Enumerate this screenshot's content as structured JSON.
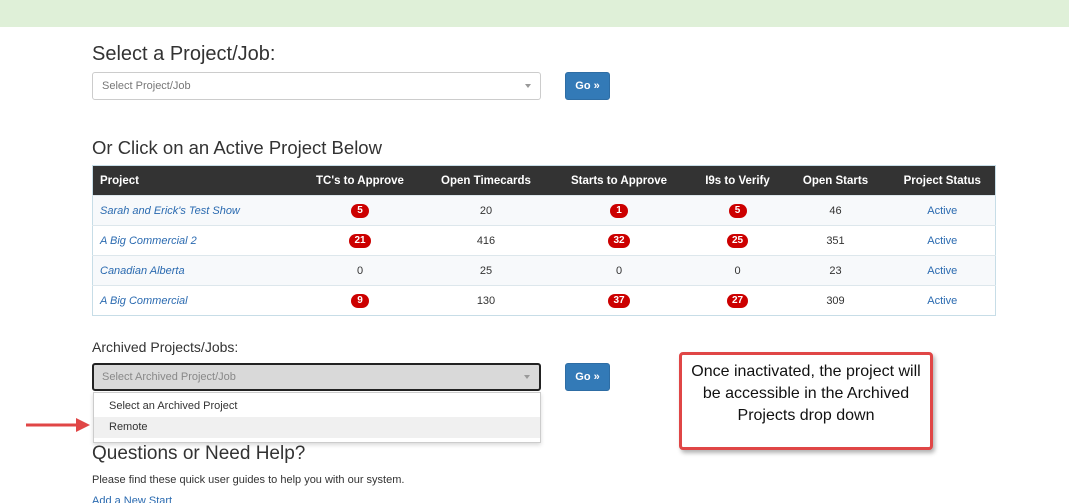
{
  "header": {
    "select_heading": "Select a Project/Job:",
    "select_placeholder": "Select Project/Job",
    "go_label": "Go »"
  },
  "active": {
    "heading": "Or Click on an Active Project Below",
    "columns": [
      "Project",
      "TC's to Approve",
      "Open Timecards",
      "Starts to Approve",
      "I9s to Verify",
      "Open Starts",
      "Project Status"
    ],
    "rows": [
      {
        "project": "Sarah and Erick's Test Show",
        "tc": "5",
        "tc_badge": true,
        "open_tc": "20",
        "starts": "1",
        "starts_badge": true,
        "i9": "5",
        "i9_badge": true,
        "open_starts": "46",
        "status": "Active"
      },
      {
        "project": "A Big Commercial 2",
        "tc": "21",
        "tc_badge": true,
        "open_tc": "416",
        "starts": "32",
        "starts_badge": true,
        "i9": "25",
        "i9_badge": true,
        "open_starts": "351",
        "status": "Active"
      },
      {
        "project": "Canadian Alberta",
        "tc": "0",
        "tc_badge": false,
        "open_tc": "25",
        "starts": "0",
        "starts_badge": false,
        "i9": "0",
        "i9_badge": false,
        "open_starts": "23",
        "status": "Active"
      },
      {
        "project": "A Big Commercial",
        "tc": "9",
        "tc_badge": true,
        "open_tc": "130",
        "starts": "37",
        "starts_badge": true,
        "i9": "27",
        "i9_badge": true,
        "open_starts": "309",
        "status": "Active"
      }
    ]
  },
  "archived": {
    "heading": "Archived Projects/Jobs:",
    "placeholder": "Select Archived Project/Job",
    "go_label": "Go »",
    "options": [
      "Select an Archived Project",
      "Remote"
    ]
  },
  "help": {
    "heading": "Questions or Need Help?",
    "text": "Please find these quick user guides to help you with our system.",
    "link": "Add a New Start"
  },
  "annotation": {
    "callout_text": "Once inactivated, the project will be accessible in the Archived Projects drop down"
  },
  "colors": {
    "banner": "#dff0d8",
    "primary": "#337ab7",
    "badge": "#cc0000",
    "callout_border": "#e04646"
  }
}
